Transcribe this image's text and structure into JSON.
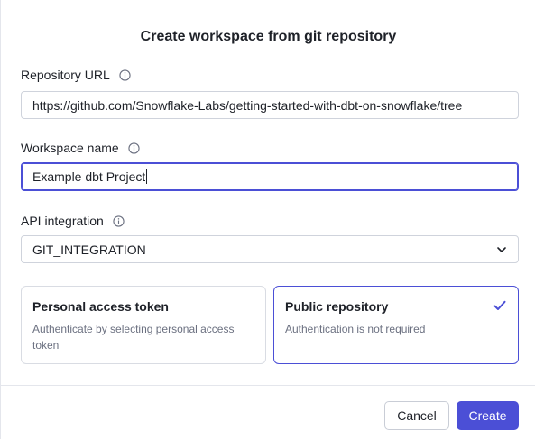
{
  "dialog": {
    "title": "Create workspace from git repository"
  },
  "repository_url": {
    "label": "Repository URL",
    "value": "https://github.com/Snowflake-Labs/getting-started-with-dbt-on-snowflake/tree"
  },
  "workspace_name": {
    "label": "Workspace name",
    "value_before": "Example ",
    "value_misspelled": "dbt",
    "value_after": " Project"
  },
  "api_integration": {
    "label": "API integration",
    "selected": "GIT_INTEGRATION"
  },
  "auth_options": [
    {
      "title": "Personal access token",
      "description": "Authenticate by selecting personal access token",
      "selected": false
    },
    {
      "title": "Public repository",
      "description": "Authentication is not required",
      "selected": true
    }
  ],
  "footer": {
    "cancel_label": "Cancel",
    "create_label": "Create"
  },
  "colors": {
    "accent": "#4b4fd6",
    "border": "#cfd3dc",
    "muted_text": "#6b7080"
  }
}
